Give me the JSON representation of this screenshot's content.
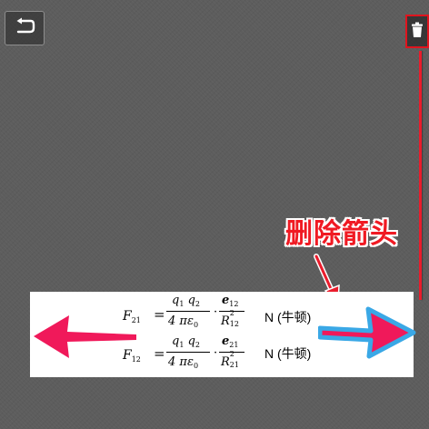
{
  "toolbar": {
    "back_icon": "undo-arrow-icon",
    "delete_icon": "trash-icon"
  },
  "annotation": {
    "label": "删除箭头",
    "color": "#f01a23"
  },
  "formula": {
    "eq1": {
      "lhs": "F",
      "lhs_sub": "21",
      "num1_a": "q",
      "num1_a_sub": "1",
      "num1_b": "q",
      "num1_b_sub": "2",
      "den1": "4 πε",
      "den1_sub": "0",
      "num2": "e",
      "num2_sub": "12",
      "den2": "R",
      "den2_sub": "12",
      "den2_sup": "2",
      "unit": "N (牛顿)"
    },
    "eq2": {
      "lhs": "F",
      "lhs_sub": "12",
      "num1_a": "q",
      "num1_a_sub": "1",
      "num1_b": "q",
      "num1_b_sub": "2",
      "den1": "4 πε",
      "den1_sub": "0",
      "num2": "e",
      "num2_sub": "21",
      "den2": "R",
      "den2_sub": "21",
      "den2_sup": "2",
      "unit": "N (牛顿)"
    }
  },
  "arrows": {
    "left_color": "#f0195a",
    "right_color": "#f0195a",
    "selection_color": "#3aa8e6"
  }
}
